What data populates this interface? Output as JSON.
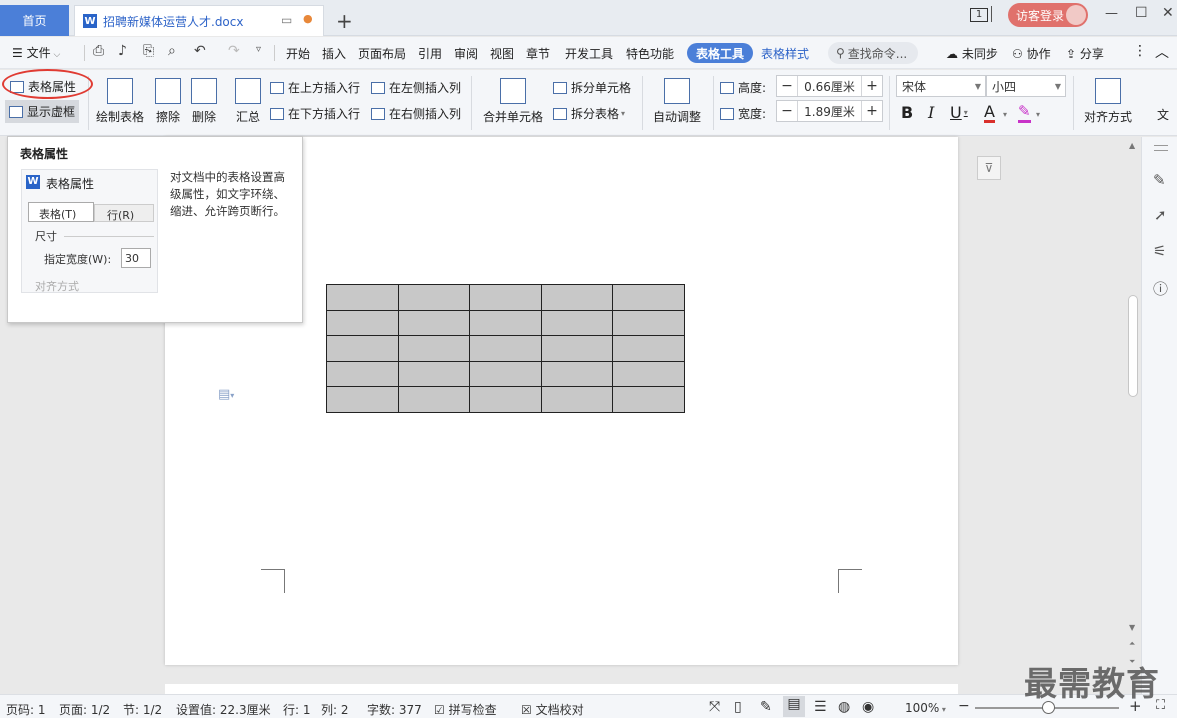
{
  "titlebar": {
    "home_tab": "首页",
    "doc_tab": "招聘新媒体运营人才.docx",
    "login": "访客登录",
    "page_indicator": "1",
    "controls": {
      "minimize": "—",
      "maximize": "☐",
      "close": "✕"
    }
  },
  "menubar": {
    "file": "文件",
    "items": [
      "开始",
      "插入",
      "页面布局",
      "引用",
      "审阅",
      "视图",
      "章节",
      "开发工具",
      "特色功能"
    ],
    "active_tab": "表格工具",
    "style_tab": "表格样式",
    "search": "查找命令...",
    "sync": "未同步",
    "collab": "协作",
    "share": "分享"
  },
  "ribbon": {
    "table_props": "表格属性",
    "show_grid": "显示虚框",
    "draw_table": "绘制表格",
    "erase": "擦除",
    "delete": "删除",
    "summary": "汇总",
    "insert_above": "在上方插入行",
    "insert_below": "在下方插入行",
    "insert_left": "在左侧插入列",
    "insert_right": "在右侧插入列",
    "merge_cells": "合并单元格",
    "split_cells": "拆分单元格",
    "split_table": "拆分表格",
    "auto_adjust": "自动调整",
    "height_label": "高度:",
    "height_value": "0.66厘米",
    "width_label": "宽度:",
    "width_value": "1.89厘米",
    "font_name": "宋体",
    "font_size": "小四",
    "bold": "B",
    "italic": "I",
    "underline": "U",
    "font_color": "A",
    "align": "对齐方式",
    "text_dir": "文"
  },
  "tooltip": {
    "title": "表格属性",
    "preview_title": "表格属性",
    "preview_tab1": "表格(T)",
    "preview_tab2": "行(R)",
    "preview_size": "尺寸",
    "preview_width": "指定宽度(W):",
    "preview_width_value": "30",
    "preview_align": "对齐方式",
    "description": "对文档中的表格设置高级属性，如文字环绕、缩进、允许跨页断行。"
  },
  "table": {
    "rows": 5,
    "cols": 5
  },
  "statusbar": {
    "page_code": "页码: 1",
    "page": "页面: 1/2",
    "section": "节: 1/2",
    "setting": "设置值: 22.3厘米",
    "line": "行: 1",
    "column": "列: 2",
    "word_count": "字数: 377",
    "spell_check": "拼写检查",
    "doc_check": "文档校对",
    "zoom": "100%"
  },
  "watermark": "最需教育",
  "colors": {
    "accent": "#4b7fd8",
    "login": "#e0716c",
    "highlight_circle": "#e03b33",
    "table_fill": "#c8c8c8"
  }
}
